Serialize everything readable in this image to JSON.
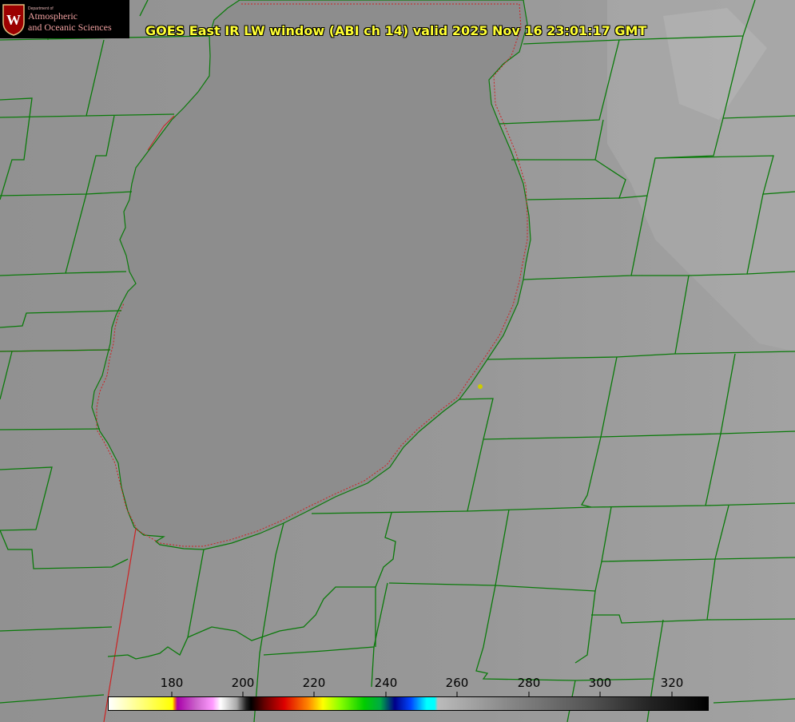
{
  "logo": {
    "department": "Department of",
    "line1": "Atmospheric",
    "line2": "and Oceanic Sciences",
    "seal_letter": "W",
    "seal_color": "#9b0000"
  },
  "title": "GOES East IR LW window (ABI ch 14) valid 2025 Nov 16 23:01:17 GMT",
  "colorbar": {
    "ticks": [
      "180",
      "200",
      "220",
      "240",
      "260",
      "280",
      "300",
      "320"
    ],
    "range": [
      163,
      331
    ]
  },
  "colors": {
    "lake": "#8e8e8e",
    "land": "#959595",
    "county_lines": "#0a7a0a",
    "state_lines": "#cc2222",
    "title_text": "#ffff33",
    "station_marker": "#cccc00"
  }
}
